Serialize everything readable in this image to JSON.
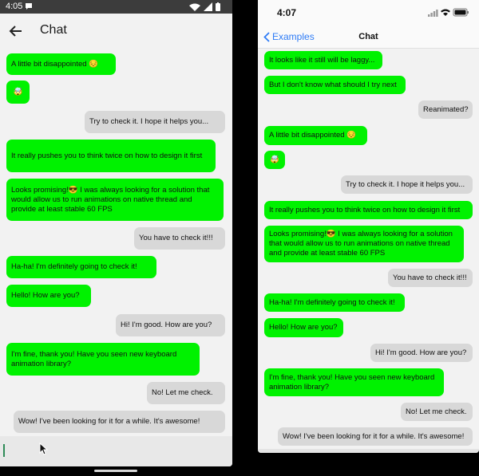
{
  "android": {
    "status": {
      "time": "4:05"
    },
    "header": {
      "title": "Chat"
    },
    "messages": [
      {
        "text": "A little bit disappointed 😔",
        "side": "in"
      },
      {
        "text": "🤯",
        "side": "in"
      },
      {
        "text": "Try to check it. I hope it helps you...",
        "side": "out"
      },
      {
        "text": "It really pushes you to think twice on how to design it first",
        "side": "in"
      },
      {
        "text": "Looks promising!😎 I was always looking for a solution that would allow us to run animations on native thread and provide at least stable 60 FPS",
        "side": "in"
      },
      {
        "text": "You have to check it!!!",
        "side": "out"
      },
      {
        "text": "Ha-ha! I'm definitely going to check it!",
        "side": "in"
      },
      {
        "text": "Hello! How are you?",
        "side": "in"
      },
      {
        "text": "Hi! I'm good. How are you?",
        "side": "out"
      },
      {
        "text": "I'm fine, thank you! Have you seen new keyboard animation library?",
        "side": "in"
      },
      {
        "text": "No! Let me check.",
        "side": "out"
      },
      {
        "text": "Wow! I've been looking for it for a while. It's awesome!",
        "side": "out"
      }
    ]
  },
  "ios": {
    "status": {
      "time": "4:07"
    },
    "header": {
      "back_label": "Examples",
      "title": "Chat"
    },
    "messages": [
      {
        "text": "It looks like it still will be laggy...",
        "side": "in"
      },
      {
        "text": "But I don't know what should I try next",
        "side": "in"
      },
      {
        "text": "Reanimated?",
        "side": "out"
      },
      {
        "text": "A little bit disappointed 😔",
        "side": "in"
      },
      {
        "text": "🤯",
        "side": "in"
      },
      {
        "text": "Try to check it. I hope it helps you...",
        "side": "out"
      },
      {
        "text": "It really pushes you to think twice on how to design it first",
        "side": "in"
      },
      {
        "text": "Looks promising!😎 I was always looking for a solution that would allow us to run animations on native thread and provide at least stable 60 FPS",
        "side": "in"
      },
      {
        "text": "You have to check it!!!",
        "side": "out"
      },
      {
        "text": "Ha-ha! I'm definitely going to check it!",
        "side": "in"
      },
      {
        "text": "Hello! How are you?",
        "side": "in"
      },
      {
        "text": "Hi! I'm good. How are you?",
        "side": "out"
      },
      {
        "text": "I'm fine, thank you! Have you seen new keyboard animation library?",
        "side": "in"
      },
      {
        "text": "No! Let me check.",
        "side": "out"
      },
      {
        "text": "Wow! I've been looking for it for a while. It's awesome!",
        "side": "out"
      }
    ]
  },
  "colors": {
    "incoming": "#00f200",
    "outgoing": "#d8d8d8",
    "link": "#2f7cf6"
  }
}
